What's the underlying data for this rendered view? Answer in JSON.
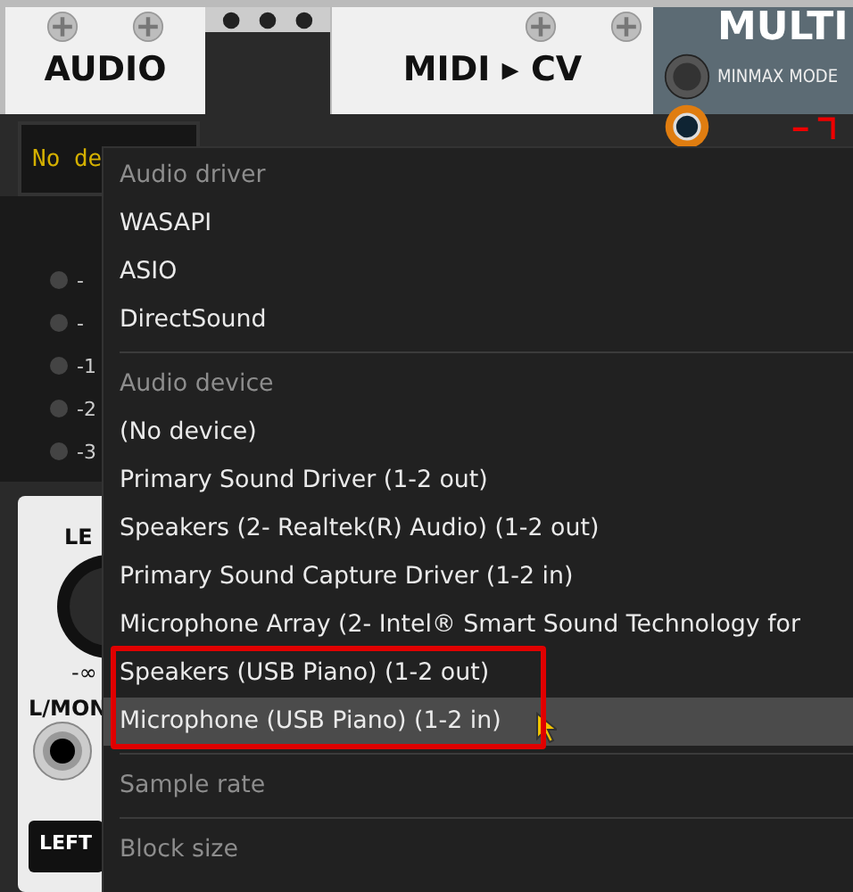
{
  "audio_module": {
    "title": "AUDIO",
    "display": "No de",
    "meter_labels": [
      "-",
      "-",
      "-1",
      "-2",
      "-3"
    ],
    "level_label": "LE",
    "knob_min": "-∞",
    "jack_label": "L/MON",
    "output_label": "LEFT"
  },
  "midi_module": {
    "title": "MIDI ▸ CV"
  },
  "multi_module": {
    "title": "MULTI",
    "mode_label": "MINMAX MODE"
  },
  "menu": {
    "sections": [
      {
        "heading": "Audio driver",
        "items": [
          {
            "label": "WASAPI",
            "selected": false,
            "outlined": false
          },
          {
            "label": "ASIO",
            "selected": false,
            "outlined": false
          },
          {
            "label": "DirectSound",
            "selected": false,
            "outlined": false
          }
        ]
      },
      {
        "heading": "Audio device",
        "items": [
          {
            "label": "(No device)",
            "selected": false,
            "outlined": false
          },
          {
            "label": "Primary Sound Driver (1-2 out)",
            "selected": false,
            "outlined": false
          },
          {
            "label": "Speakers (2- Realtek(R) Audio) (1-2 out)",
            "selected": false,
            "outlined": false
          },
          {
            "label": "Primary Sound Capture Driver (1-2 in)",
            "selected": false,
            "outlined": false
          },
          {
            "label": "Microphone Array (2- Intel® Smart Sound Technology for",
            "selected": false,
            "outlined": false
          },
          {
            "label": "Speakers (USB Piano) (1-2 out)",
            "selected": false,
            "outlined": true
          },
          {
            "label": "Microphone (USB Piano) (1-2 in)",
            "selected": true,
            "outlined": true
          }
        ]
      },
      {
        "heading": "Sample rate"
      },
      {
        "heading": "Block size"
      }
    ]
  }
}
